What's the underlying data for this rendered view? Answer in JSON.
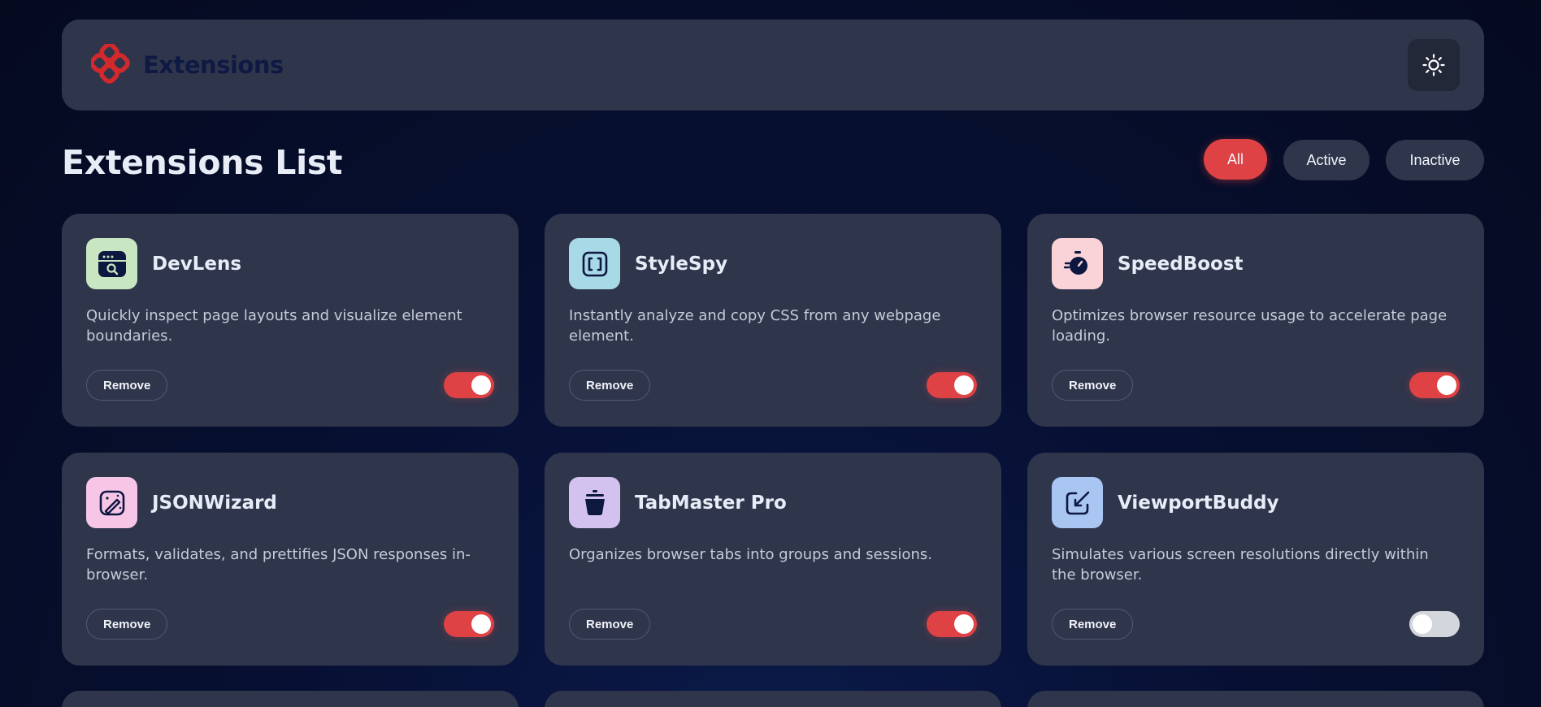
{
  "header": {
    "brand_name": "Extensions",
    "logo_icon": "extensions-logo",
    "theme_toggle_icon": "sun-icon",
    "brand_color": "#de4244"
  },
  "main": {
    "title": "Extensions List",
    "filters": [
      {
        "label": "All",
        "selected": true
      },
      {
        "label": "Active",
        "selected": false
      },
      {
        "label": "Inactive",
        "selected": false
      }
    ]
  },
  "extensions": [
    {
      "name": "DevLens",
      "description": "Quickly inspect page layouts and visualize element boundaries.",
      "remove_label": "Remove",
      "active": true,
      "icon": "devlens-icon",
      "icon_bg": "#c9e6c2"
    },
    {
      "name": "StyleSpy",
      "description": "Instantly analyze and copy CSS from any webpage element.",
      "remove_label": "Remove",
      "active": true,
      "icon": "stylespy-icon",
      "icon_bg": "#a8d9e6"
    },
    {
      "name": "SpeedBoost",
      "description": "Optimizes browser resource usage to accelerate page loading.",
      "remove_label": "Remove",
      "active": true,
      "icon": "speedboost-icon",
      "icon_bg": "#fad3d8"
    },
    {
      "name": "JSONWizard",
      "description": "Formats, validates, and prettifies JSON responses in-browser.",
      "remove_label": "Remove",
      "active": true,
      "icon": "jsonwizard-icon",
      "icon_bg": "#f7c6e6"
    },
    {
      "name": "TabMaster Pro",
      "description": "Organizes browser tabs into groups and sessions.",
      "remove_label": "Remove",
      "active": true,
      "icon": "tabmaster-icon",
      "icon_bg": "#d3c2ef"
    },
    {
      "name": "ViewportBuddy",
      "description": "Simulates various screen resolutions directly within the browser.",
      "remove_label": "Remove",
      "active": false,
      "icon": "viewportbuddy-icon",
      "icon_bg": "#a9c6f2"
    }
  ]
}
